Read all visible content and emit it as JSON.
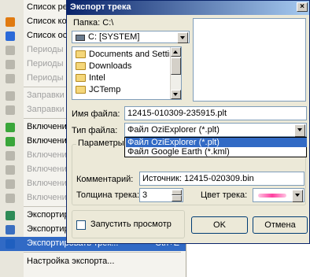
{
  "menu": {
    "items": [
      {
        "label": "Список рей",
        "disabled": false,
        "icon": "list-icon"
      },
      {
        "label": "Список кон",
        "disabled": false,
        "icon": "list-c-icon",
        "color": "#e07a10"
      },
      {
        "label": "Список ост",
        "disabled": false,
        "icon": "list-p-icon",
        "color": "#2b6ad8"
      },
      {
        "label": "Периоды о",
        "disabled": true
      },
      {
        "label": "Периоды п",
        "disabled": true
      },
      {
        "label": "Периоды п",
        "disabled": true
      },
      {
        "label": "Заправки и",
        "disabled": true
      },
      {
        "label": "Заправки и",
        "disabled": true
      },
      {
        "label": "Включение",
        "disabled": false,
        "color": "#3aa63a"
      },
      {
        "label": "Включение",
        "disabled": false,
        "color": "#3aa63a"
      },
      {
        "label": "Включение",
        "disabled": true
      },
      {
        "label": "Включение",
        "disabled": true
      },
      {
        "label": "Включение",
        "disabled": true
      },
      {
        "label": "Включение",
        "disabled": true
      },
      {
        "label": "Экспортир",
        "disabled": false,
        "color": "#2e8b57"
      },
      {
        "label": "Экспортир",
        "disabled": false,
        "color": "#3b6fc0"
      },
      {
        "label": "Экспортировать трек...",
        "shortcut": "Ctrl+E",
        "selected": true,
        "color": "#1f5fbf"
      },
      {
        "label": "Настройка экспорта...",
        "disabled": false
      }
    ]
  },
  "dialog": {
    "title": "Экспорт трека",
    "close": "×",
    "folder_label": "Папка:",
    "folder_path": "C:\\",
    "drive": "C: [SYSTEM]",
    "folders": [
      "Documents and Settings",
      "Downloads",
      "Intel",
      "JCTemp"
    ],
    "filename_label": "Имя файла:",
    "filename_value": "12415-010309-235915.plt",
    "filetype_label": "Тип файла:",
    "filetype_value": "Файл OziExplorer (*.plt)",
    "filetype_options": [
      "Файл OziExplorer (*.plt)",
      "Файл Google Earth (*.kml)"
    ],
    "params_title": "Параметры файла",
    "comment_label": "Комментарий:",
    "comment_value": "Источник: 12415-020309.bin",
    "thickness_label": "Толщина трека:",
    "thickness_value": "3",
    "color_label": "Цвет трека:",
    "track_color": "#ff3fa0",
    "launch_label": "Запустить просмотр",
    "ok_label": "OK",
    "cancel_label": "Отмена"
  }
}
